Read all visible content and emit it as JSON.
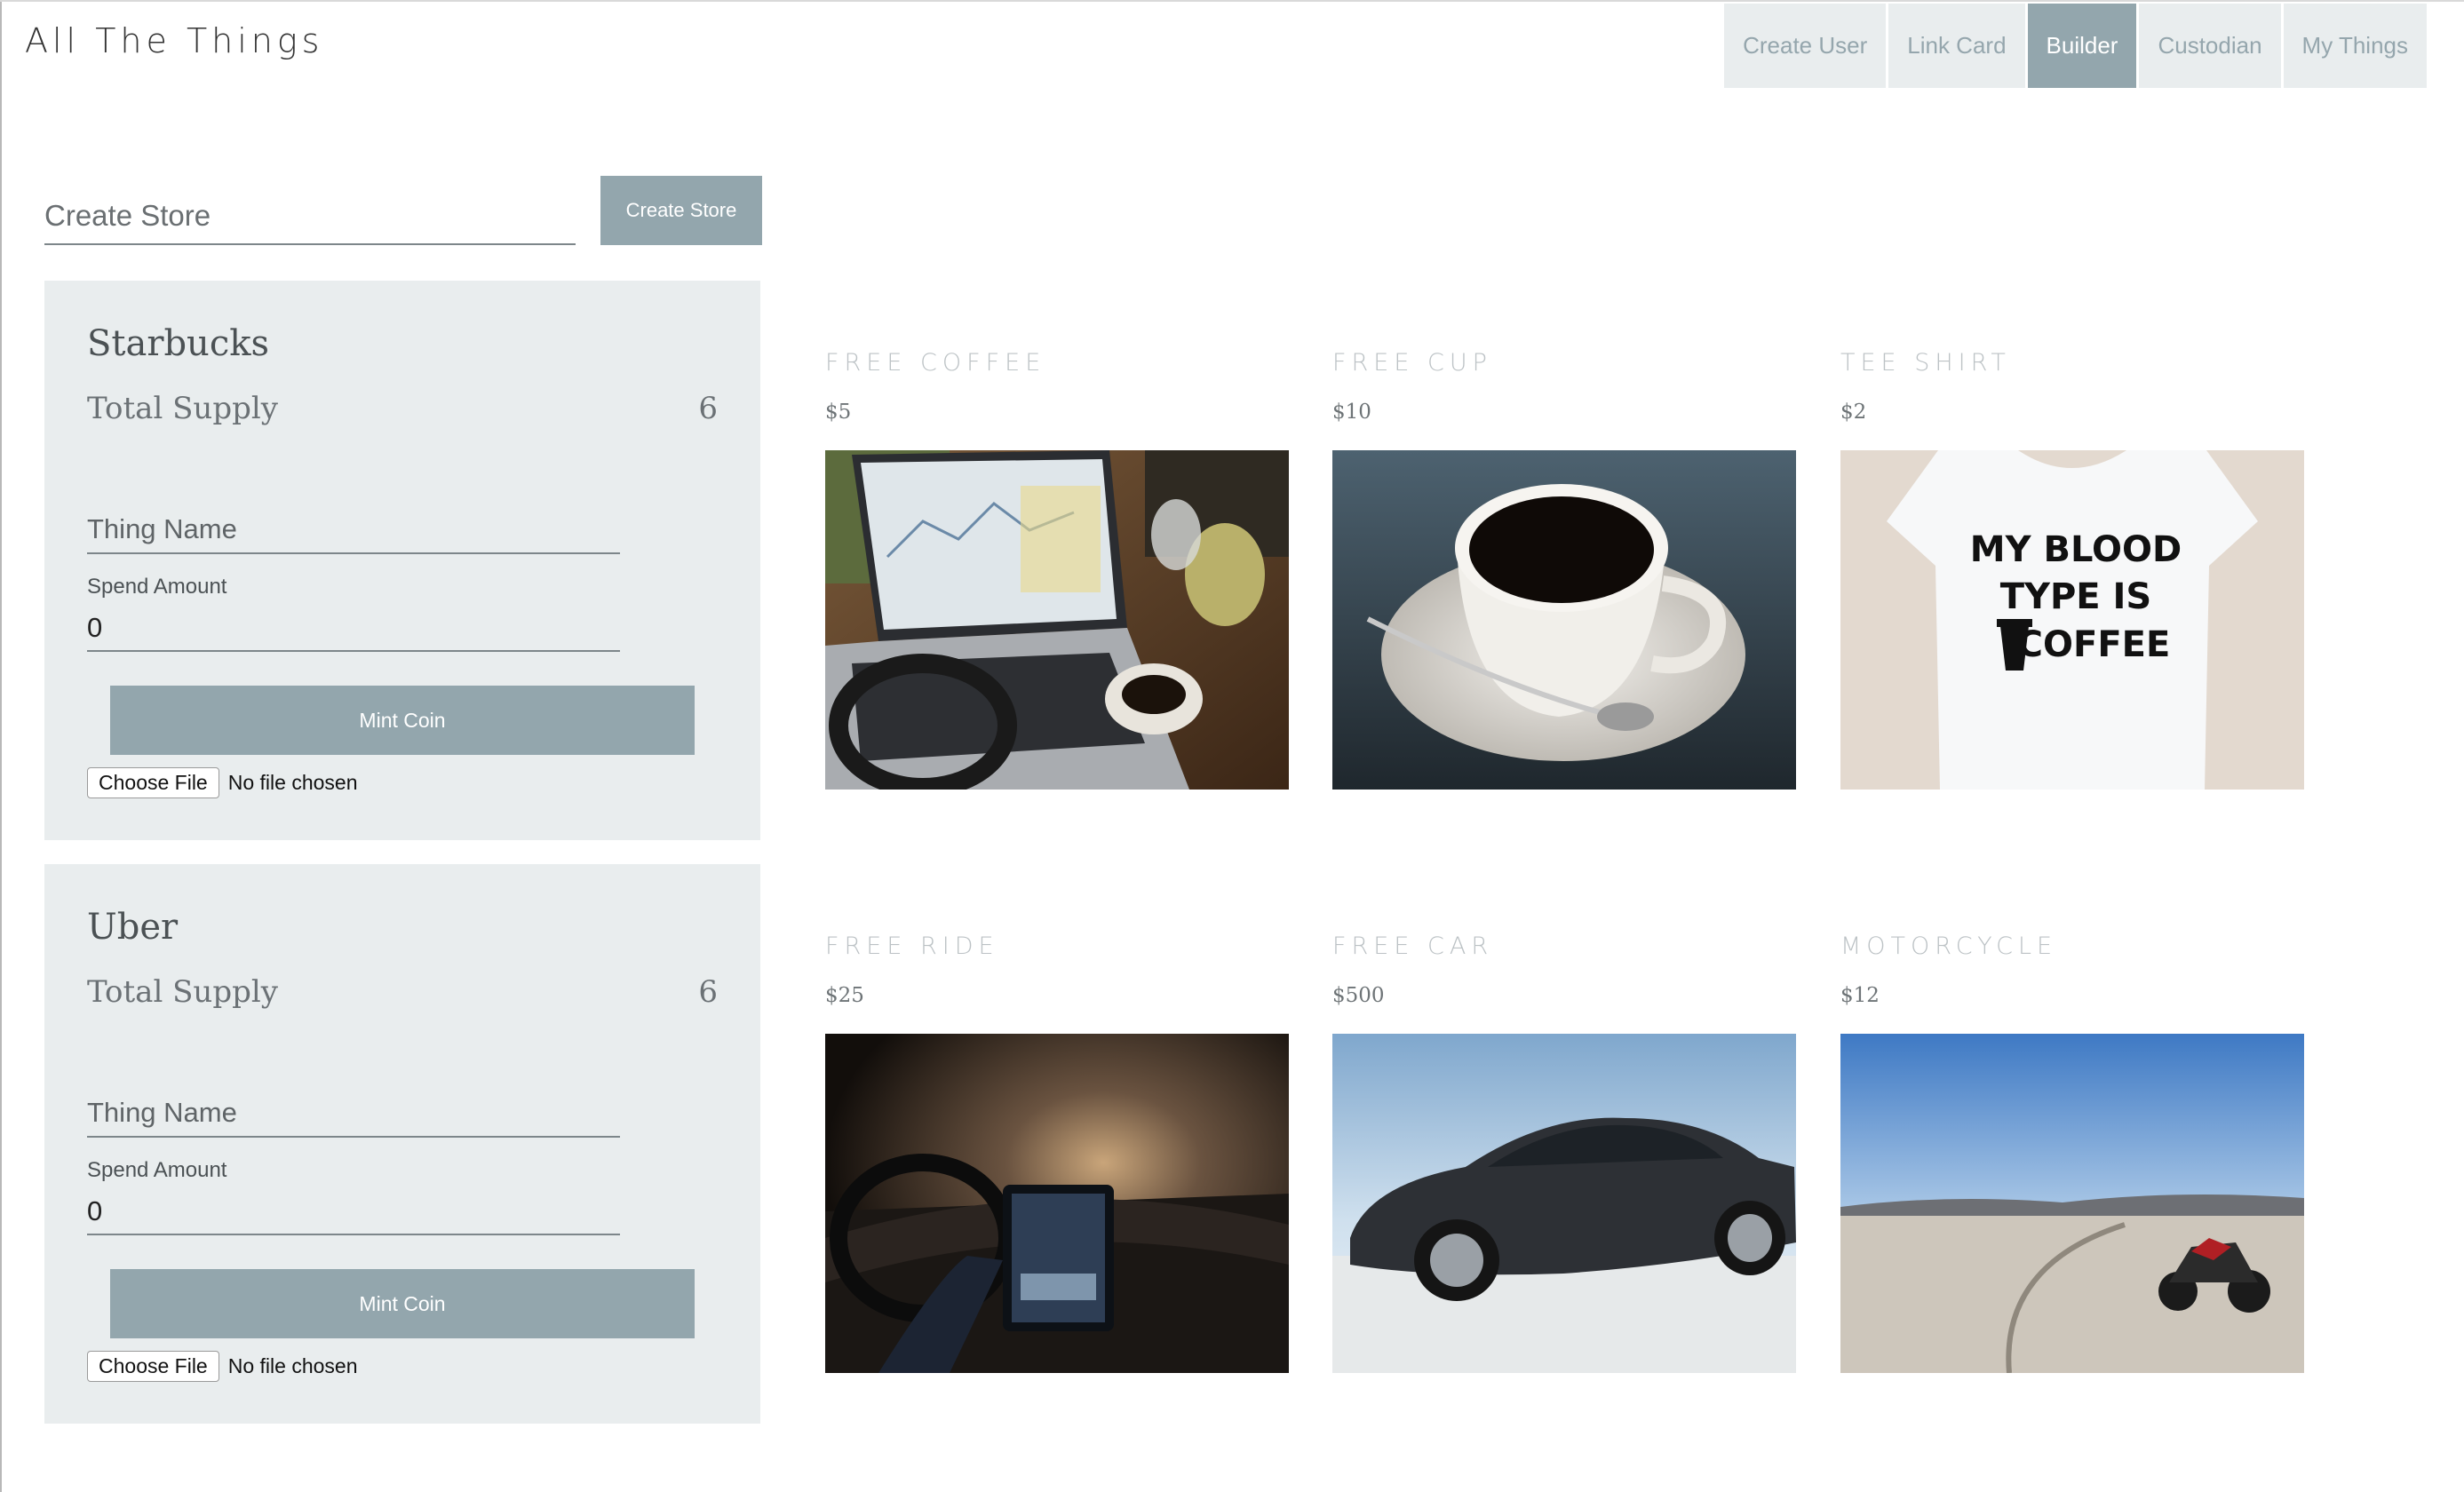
{
  "app": {
    "title": "All The Things"
  },
  "nav": {
    "tabs": [
      {
        "label": "Create User",
        "active": false
      },
      {
        "label": "Link Card",
        "active": false
      },
      {
        "label": "Builder",
        "active": true
      },
      {
        "label": "Custodian",
        "active": false
      },
      {
        "label": "My Things",
        "active": false
      }
    ]
  },
  "create_store": {
    "placeholder": "Create Store",
    "value": "",
    "button_label": "Create Store"
  },
  "stores": [
    {
      "name": "Starbucks",
      "supply_label": "Total Supply",
      "supply_value": "6",
      "thing_name_placeholder": "Thing Name",
      "thing_name_value": "",
      "spend_label": "Spend Amount",
      "spend_value": "0",
      "mint_label": "Mint Coin",
      "file_button": "Choose File",
      "file_status": "No file chosen"
    },
    {
      "name": "Uber",
      "supply_label": "Total Supply",
      "supply_value": "6",
      "thing_name_placeholder": "Thing Name",
      "thing_name_value": "",
      "spend_label": "Spend Amount",
      "spend_value": "0",
      "mint_label": "Mint Coin",
      "file_button": "Choose File",
      "file_status": "No file chosen"
    }
  ],
  "products": [
    {
      "name": "FREE COFFEE",
      "price": "$5"
    },
    {
      "name": "FREE CUP",
      "price": "$10"
    },
    {
      "name": "TEE SHIRT",
      "price": "$2",
      "shirt_text": [
        "MY BLOOD",
        "TYPE IS",
        "COFFEE"
      ]
    },
    {
      "name": "FREE RIDE",
      "price": "$25"
    },
    {
      "name": "FREE CAR",
      "price": "$500"
    },
    {
      "name": "MOTORCYCLE",
      "price": "$12"
    }
  ],
  "colors": {
    "accent": "#93a6ad",
    "tab_bg": "#e9edee",
    "card_bg": "#e9edee",
    "product_title": "#bcc2c5"
  }
}
